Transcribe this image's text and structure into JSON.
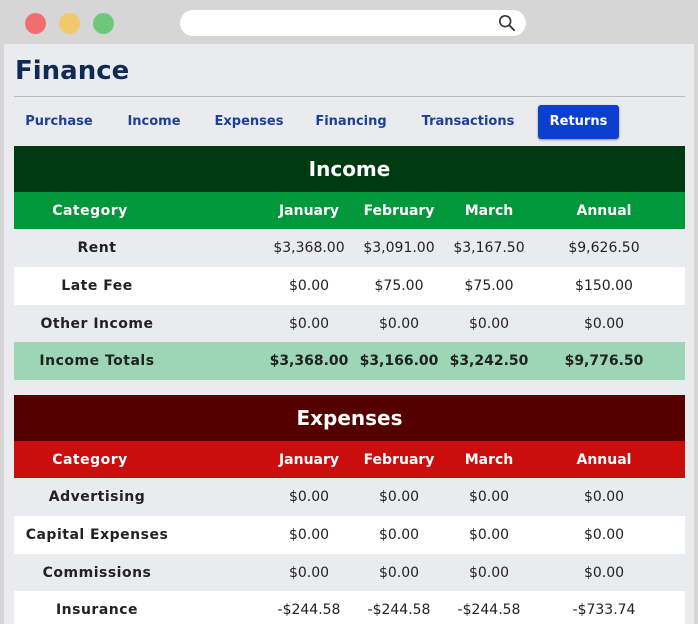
{
  "search": {
    "value": "",
    "placeholder": ""
  },
  "page_title": "Finance",
  "tabs": [
    {
      "label": "Purchase",
      "active": false
    },
    {
      "label": "Income",
      "active": false
    },
    {
      "label": "Expenses",
      "active": false
    },
    {
      "label": "Financing",
      "active": false
    },
    {
      "label": "Transactions",
      "active": false
    },
    {
      "label": "Returns",
      "active": true
    }
  ],
  "colors": {
    "income_header": "#003a12",
    "income_columns": "#00983a",
    "income_total": "#9dd6b4",
    "expenses_header": "#540000",
    "expenses_columns": "#cc0d0d",
    "active_tab": "#0a3fcf"
  },
  "income": {
    "title": "Income",
    "columns": [
      "Category",
      "January",
      "February",
      "March",
      "Annual"
    ],
    "rows": [
      {
        "category": "Rent",
        "jan": "$3,368.00",
        "feb": "$3,091.00",
        "mar": "$3,167.50",
        "annual": "$9,626.50"
      },
      {
        "category": "Late Fee",
        "jan": "$0.00",
        "feb": "$75.00",
        "mar": "$75.00",
        "annual": "$150.00"
      },
      {
        "category": "Other Income",
        "jan": "$0.00",
        "feb": "$0.00",
        "mar": "$0.00",
        "annual": "$0.00"
      }
    ],
    "totals": {
      "category": "Income Totals",
      "jan": "$3,368.00",
      "feb": "$3,166.00",
      "mar": "$3,242.50",
      "annual": "$9,776.50"
    }
  },
  "expenses": {
    "title": "Expenses",
    "columns": [
      "Category",
      "January",
      "February",
      "March",
      "Annual"
    ],
    "rows": [
      {
        "category": "Advertising",
        "jan": "$0.00",
        "feb": "$0.00",
        "mar": "$0.00",
        "annual": "$0.00"
      },
      {
        "category": "Capital Expenses",
        "jan": "$0.00",
        "feb": "$0.00",
        "mar": "$0.00",
        "annual": "$0.00"
      },
      {
        "category": "Commissions",
        "jan": "$0.00",
        "feb": "$0.00",
        "mar": "$0.00",
        "annual": "$0.00"
      },
      {
        "category": "Insurance",
        "jan": "-$244.58",
        "feb": "-$244.58",
        "mar": "-$244.58",
        "annual": "-$733.74"
      }
    ]
  }
}
